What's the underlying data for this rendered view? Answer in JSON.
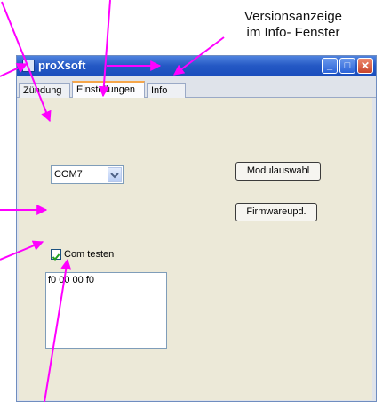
{
  "annotation": {
    "line1": "Versionsanzeige",
    "line2": "im Info- Fenster"
  },
  "window": {
    "title": "proXsoft",
    "controls": {
      "minimize": "_",
      "maximize": "□",
      "close": "✕"
    }
  },
  "tabs": [
    {
      "label": "Zündung"
    },
    {
      "label": "Einstellungen"
    },
    {
      "label": "Info"
    }
  ],
  "settings": {
    "com_port": {
      "value": "COM7"
    },
    "modulauswahl_label": "Modulauswahl",
    "firmware_label": "Firmwareupd.",
    "com_test": {
      "label": "Com testen",
      "checked": true
    },
    "output_text": "f0 00 00 f0"
  },
  "colors": {
    "arrow": "#ff00ff",
    "titlebar": "#2458c4",
    "active_tab_accent": "#f5a64a"
  }
}
